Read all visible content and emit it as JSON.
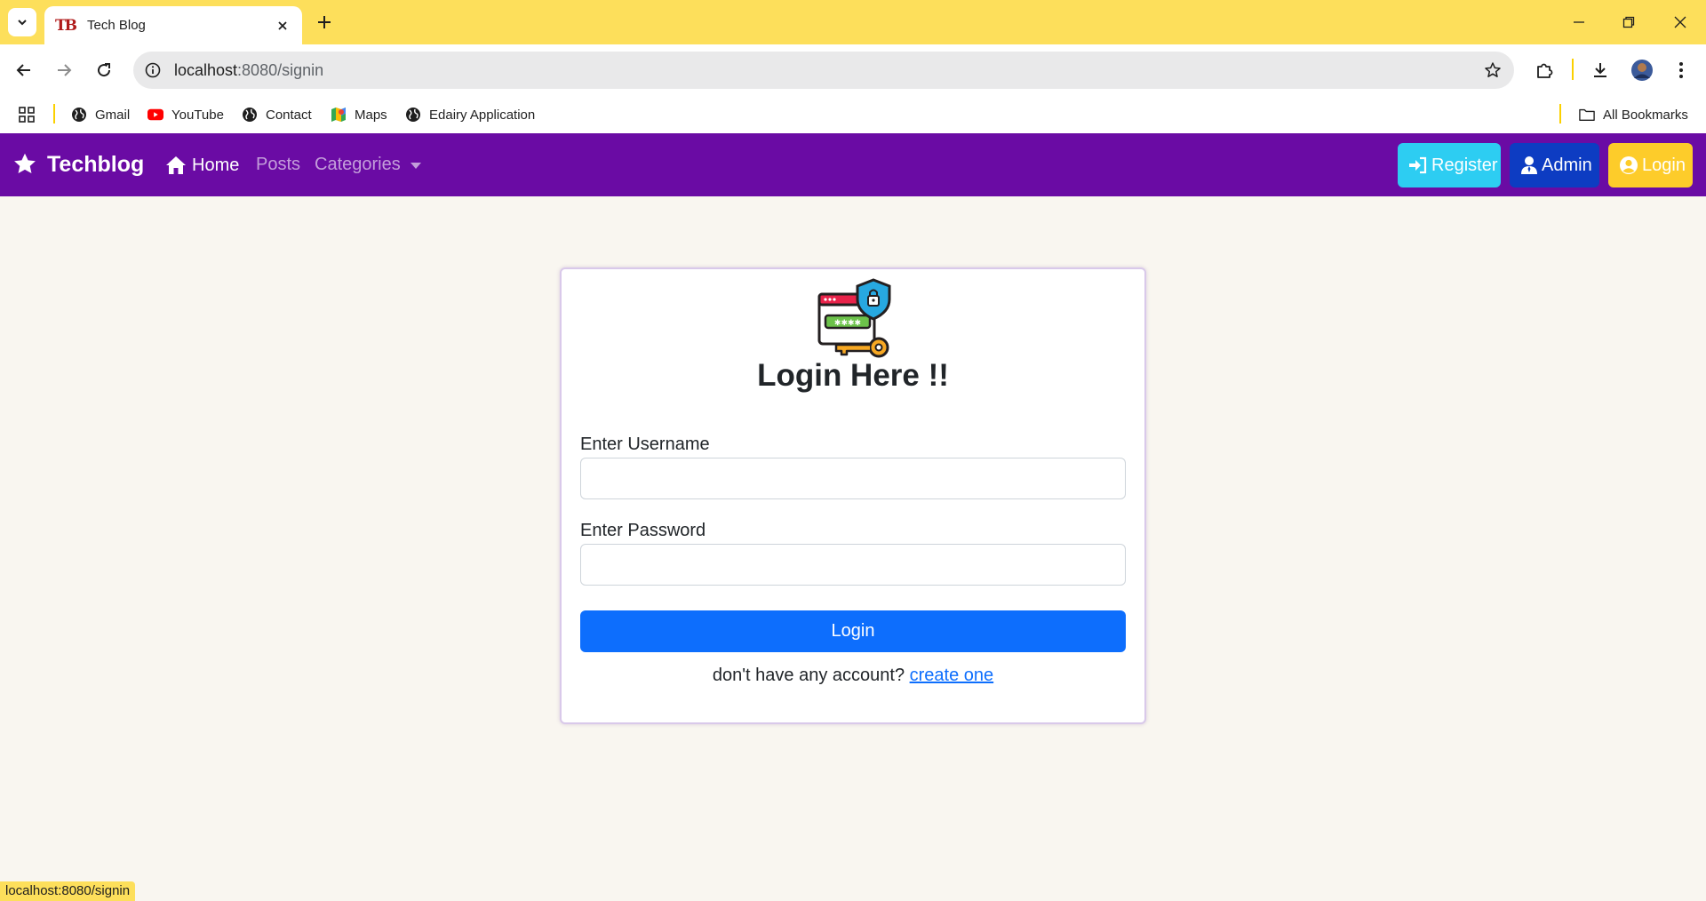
{
  "browser": {
    "tab_title": "Tech Blog",
    "tab_favicon_text": "TB",
    "url_host": "localhost",
    "url_rest": ":8080/signin",
    "bookmarks": [
      {
        "label": "Gmail",
        "icon": "globe-icon"
      },
      {
        "label": "YouTube",
        "icon": "youtube-icon"
      },
      {
        "label": "Contact",
        "icon": "globe-icon"
      },
      {
        "label": "Maps",
        "icon": "maps-icon"
      },
      {
        "label": "Edairy Application",
        "icon": "globe-icon"
      }
    ],
    "all_bookmarks_label": "All Bookmarks",
    "status_url": "localhost:8080/signin",
    "colors": {
      "chrome_accent": "#fddf5b"
    }
  },
  "site": {
    "brand": "Techblog",
    "nav": {
      "home": "Home",
      "posts": "Posts",
      "categories": "Categories"
    },
    "buttons": {
      "register": "Register",
      "admin": "Admin",
      "login": "Login"
    },
    "colors": {
      "navbar": "#6a0ba4",
      "register": "#2dcdf2",
      "admin": "#0d3cc2",
      "login": "#fdcc2a",
      "primary": "#0d6efd",
      "page_bg": "#f9f6f0"
    }
  },
  "login_card": {
    "title": "Login Here !!",
    "username_label": "Enter Username",
    "username_value": "",
    "password_label": "Enter Password",
    "password_value": "",
    "submit_label": "Login",
    "footer_text": "don't have any account?",
    "footer_link": "create one"
  }
}
